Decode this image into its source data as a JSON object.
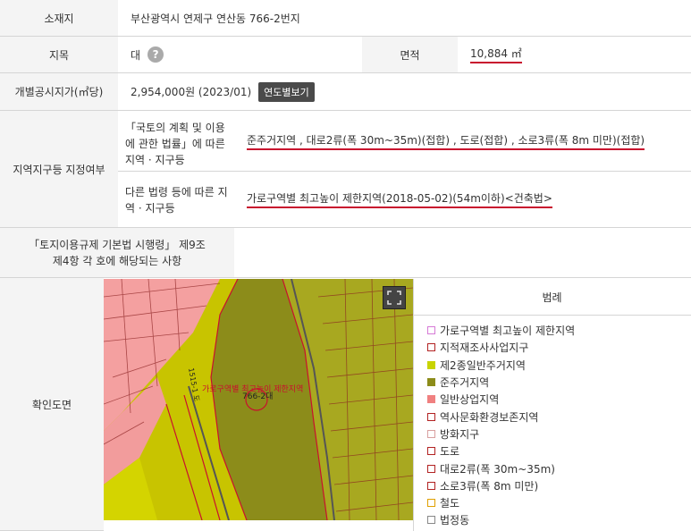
{
  "rows": {
    "location": {
      "label": "소재지",
      "value": "부산광역시 연제구 연산동 766-2번지"
    },
    "land_category": {
      "label": "지목",
      "value": "대",
      "help": "?"
    },
    "area": {
      "label": "면적",
      "value": "10,884 ㎡"
    },
    "price": {
      "label": "개별공시지가(㎡당)",
      "value": "2,954,000원 (2023/01)",
      "button": "연도별보기"
    },
    "zoning": {
      "label": "지역지구등 지정여부",
      "sub1_label": "「국토의 계획 및 이용에 관한 법률」에 따른 지역 · 지구등",
      "sub1_value": "준주거지역 , 대로2류(폭 30m~35m)(접합) , 도로(접합) , 소로3류(폭 8m 미만)(접합)",
      "sub2_label": "다른 법령 등에 따른 지역 · 지구등",
      "sub2_value": "가로구역별 최고높이 제한지역(2018-05-02)(54m이하)<건축법>"
    },
    "regulation": {
      "label": "「토지이용규제 기본법 시행령」 제9조 제4항 각 호에 해당되는 사항",
      "value": ""
    },
    "map": {
      "label": "확인도면"
    }
  },
  "map_labels": {
    "lot": "766-2대",
    "height_zone": "가로구역별 최고높이 제한지역",
    "road": "1515-1 도"
  },
  "legend": {
    "title": "범례",
    "items": [
      {
        "label": "가로구역별 최고높이 제한지역",
        "color": "#d67ad6",
        "fill": "#ffffff"
      },
      {
        "label": "지적재조사사업지구",
        "color": "#b22222",
        "fill": "#ffffff"
      },
      {
        "label": "제2종일반주거지역",
        "color": "#c8d400",
        "fill": "#c8d400"
      },
      {
        "label": "준주거지역",
        "color": "#8c8c1a",
        "fill": "#8c8c1a"
      },
      {
        "label": "일반상업지역",
        "color": "#f08080",
        "fill": "#f08080"
      },
      {
        "label": "역사문화환경보존지역",
        "color": "#b22222",
        "fill": "#ffffff"
      },
      {
        "label": "방화지구",
        "color": "#d9a0a0",
        "fill": "#ffffff"
      },
      {
        "label": "도로",
        "color": "#b22222",
        "fill": "#ffffff"
      },
      {
        "label": "대로2류(폭 30m~35m)",
        "color": "#b22222",
        "fill": "#ffffff"
      },
      {
        "label": "소로3류(폭 8m 미만)",
        "color": "#b22222",
        "fill": "#ffffff"
      },
      {
        "label": "철도",
        "color": "#e0a000",
        "fill": "#ffffff"
      },
      {
        "label": "법정동",
        "color": "#888888",
        "fill": "#ffffff"
      }
    ]
  }
}
